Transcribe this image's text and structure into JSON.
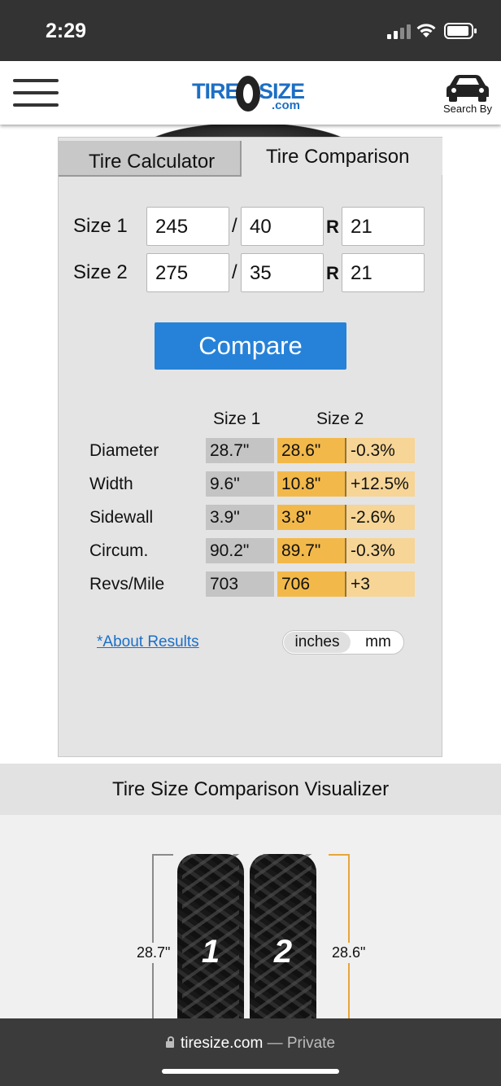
{
  "status_bar": {
    "time": "2:29"
  },
  "header": {
    "logo_part1": "TIRE",
    "logo_part2": "SIZE",
    "logo_com": ".com",
    "search_by": "Search By"
  },
  "tabs": {
    "calculator": "Tire Calculator",
    "comparison": "Tire Comparison",
    "active": "Tire Comparison"
  },
  "size_inputs": [
    {
      "label": "Size 1",
      "width": "245",
      "aspect": "40",
      "rim": "21"
    },
    {
      "label": "Size 2",
      "width": "275",
      "aspect": "35",
      "rim": "21"
    }
  ],
  "separators": {
    "slash": "/",
    "r": "R"
  },
  "compare_button": "Compare",
  "results": {
    "headers": [
      "Size 1",
      "Size 2"
    ],
    "rows": [
      {
        "label": "Diameter",
        "size1": "28.7\"",
        "size2": "28.6\"",
        "diff": "-0.3%"
      },
      {
        "label": "Width",
        "size1": "9.6\"",
        "size2": "10.8\"",
        "diff": "+12.5%"
      },
      {
        "label": "Sidewall",
        "size1": "3.9\"",
        "size2": "3.8\"",
        "diff": "-2.6%"
      },
      {
        "label": "Circum.",
        "size1": "90.2\"",
        "size2": "89.7\"",
        "diff": "-0.3%"
      },
      {
        "label": "Revs/Mile",
        "size1": "703",
        "size2": "706",
        "diff": "+3"
      }
    ]
  },
  "about_link": "*About Results",
  "units": {
    "inches": "inches",
    "mm": "mm",
    "selected": "inches"
  },
  "visualizer": {
    "title": "Tire Size Comparison Visualizer",
    "tire1_number": "1",
    "tire2_number": "2",
    "tire1_diameter": "28.7\"",
    "tire2_diameter": "28.6\""
  },
  "url_bar": {
    "host": "tiresize.com",
    "mode": " — Private"
  },
  "colors": {
    "primary_blue": "#2682d8",
    "size1_cell": "#c4c4c4",
    "size2_cell": "#f2b94a",
    "diff_cell": "#f6d596"
  }
}
